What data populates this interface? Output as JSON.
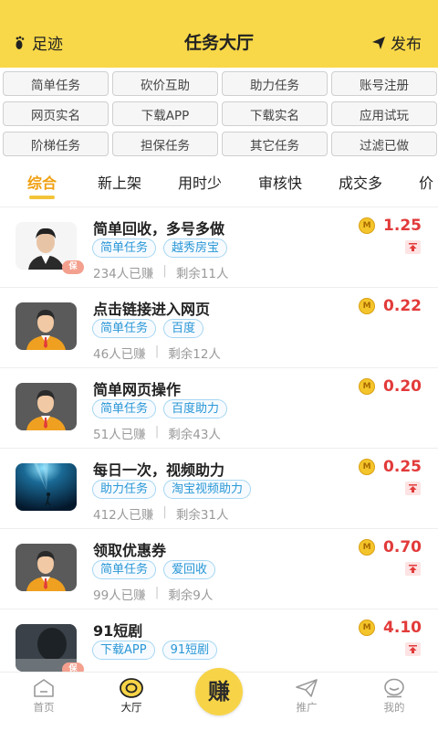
{
  "header": {
    "left_label": "足迹",
    "title": "任务大厅",
    "right_label": "发布"
  },
  "categories": [
    "简单任务",
    "砍价互助",
    "助力任务",
    "账号注册",
    "网页实名",
    "下载APP",
    "下载实名",
    "应用试玩",
    "阶梯任务",
    "担保任务",
    "其它任务",
    "过滤已做"
  ],
  "sort_tabs": [
    "综合",
    "新上架",
    "用时少",
    "审核快",
    "成交多",
    "价"
  ],
  "tasks": [
    {
      "title": "简单回收，多号多做",
      "tags": [
        "简单任务",
        "越秀房宝"
      ],
      "earned": "234人已赚",
      "remaining": "剩余11人",
      "price": "1.25",
      "pinned": true,
      "avatar": "person-photo",
      "guarantee": true
    },
    {
      "title": "点击链接进入网页",
      "tags": [
        "简单任务",
        "百度"
      ],
      "earned": "46人已赚",
      "remaining": "剩余12人",
      "price": "0.22",
      "pinned": false,
      "avatar": "default-avatar",
      "guarantee": false
    },
    {
      "title": "简单网页操作",
      "tags": [
        "简单任务",
        "百度助力"
      ],
      "earned": "51人已赚",
      "remaining": "剩余43人",
      "price": "0.20",
      "pinned": false,
      "avatar": "default-avatar",
      "guarantee": false
    },
    {
      "title": "每日一次，视频助力",
      "tags": [
        "助力任务",
        "淘宝视频助力"
      ],
      "earned": "412人已赚",
      "remaining": "剩余31人",
      "price": "0.25",
      "pinned": true,
      "avatar": "ocean-photo",
      "guarantee": false
    },
    {
      "title": "领取优惠券",
      "tags": [
        "简单任务",
        "爱回收"
      ],
      "earned": "99人已赚",
      "remaining": "剩余9人",
      "price": "0.70",
      "pinned": true,
      "avatar": "default-avatar",
      "guarantee": false
    },
    {
      "title": "91短剧",
      "tags": [
        "下载APP",
        "91短剧"
      ],
      "earned": "",
      "remaining": "",
      "price": "4.10",
      "pinned": true,
      "avatar": "dark-photo",
      "guarantee": true
    }
  ],
  "guarantee_badge": "保",
  "coin_label": "M",
  "bottom_nav": {
    "home": "首页",
    "hall": "大厅",
    "earn": "赚",
    "promote": "推广",
    "mine": "我的"
  },
  "colors": {
    "brand_yellow": "#f8d848",
    "active_tab": "#f0a010",
    "price_red": "#e23a3a",
    "tag_blue": "#2a97d6"
  }
}
